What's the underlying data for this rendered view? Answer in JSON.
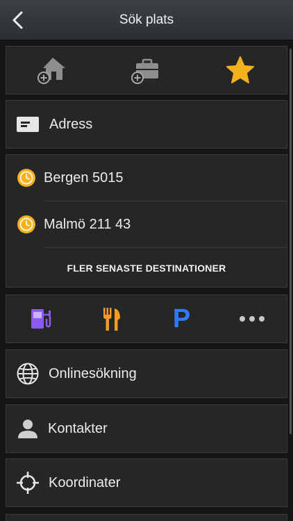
{
  "header": {
    "title": "Sök plats"
  },
  "quick_icons": [
    {
      "icon": "home-add-icon"
    },
    {
      "icon": "work-add-icon"
    },
    {
      "icon": "favorites-star-icon"
    }
  ],
  "address": {
    "label": "Adress"
  },
  "recent": {
    "items": [
      {
        "label": "Bergen 5015"
      },
      {
        "label": "Malmö 211 43"
      }
    ],
    "more_label": "FLER SENASTE DESTINATIONER"
  },
  "categories": [
    {
      "icon": "fuel-station-icon"
    },
    {
      "icon": "restaurant-icon"
    },
    {
      "icon": "parking-icon",
      "glyph": "P"
    },
    {
      "icon": "more-icon"
    }
  ],
  "menu": {
    "online": "Onlinesökning",
    "contacts": "Kontakter",
    "coordinates": "Koordinater"
  },
  "colors": {
    "accent_yellow": "#f5b01e",
    "fuel_purple": "#8a5cf0",
    "food_orange": "#f59a23",
    "parking_blue": "#2f7bf2"
  }
}
